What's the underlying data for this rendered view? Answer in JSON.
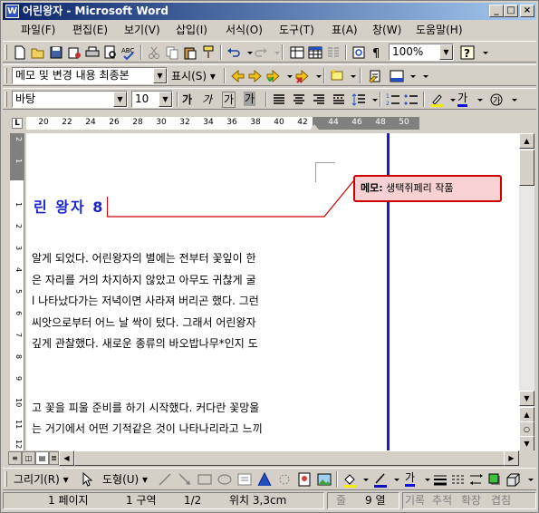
{
  "window": {
    "title": "어린왕자 - Microsoft Word",
    "icon": "word-doc-icon",
    "controls": [
      "minimize",
      "maximize",
      "close"
    ]
  },
  "menu": [
    "파일(F)",
    "편집(E)",
    "보기(V)",
    "삽입(I)",
    "서식(O)",
    "도구(T)",
    "표(A)",
    "창(W)",
    "도움말(H)"
  ],
  "toolbar_standard": {
    "zoom": "100%"
  },
  "toolbar_review": {
    "display_mode": "메모 및 변경 내용 최종본",
    "show_label": "표시(S)"
  },
  "toolbar_format": {
    "style": "바탕",
    "font_size": "10",
    "bold": "가",
    "italic": "가",
    "underline": "가",
    "shade": "가",
    "font_color": "가"
  },
  "ruler": {
    "numbers": [
      "20",
      "22",
      "24",
      "26",
      "28",
      "30",
      "32",
      "34",
      "36",
      "38",
      "40",
      "42",
      "44",
      "46",
      "48",
      "50"
    ],
    "tab_selector": "L"
  },
  "vruler": {
    "numbers": [
      "2",
      "1",
      "1",
      "2",
      "3",
      "4",
      "5",
      "6",
      "7",
      "8",
      "9",
      "10",
      "11",
      "12"
    ]
  },
  "document": {
    "heading": "린 왕자 8",
    "lines": [
      "알게 되었다. 어린왕자의 별에는 전부터 꽃잎이 한",
      "은 자리를 거의 차지하지 않았고 아무도 귀찮게 굴",
      "l 나타났다가는 저녁이면 사라져 버리곤 했다. 그런",
      " 씨앗으로부터 어느 날 싹이 텄다. 그래서 어린왕자",
      " 깊게 관찰했다. 새로운 종류의 바오밥나무*인지 도",
      "",
      "",
      "고 꽃을 피울 준비를 하기 시작했다. 커다란 꽃망울",
      "는 거기에서 어떤 기적같은 것이 나타나리라고 느끼"
    ]
  },
  "comment": {
    "label": "메모:",
    "text": "생택쥐페리 작품"
  },
  "drawing_toolbar": {
    "draw_label": "그리기(R)",
    "shapes_label": "도형(U)",
    "font_color": "가"
  },
  "status": {
    "page": "1 페이지",
    "section": "1 구역",
    "pages": "1/2",
    "position": "위치 3,3cm",
    "line": "줄",
    "column": "9 열",
    "rec": "기록",
    "track": "추적",
    "ext": "확장",
    "ovr": "겹침"
  },
  "colors": {
    "title_start": "#0a246a",
    "title_end": "#a6caf0",
    "heading": "#1b26c9",
    "comment_border": "#cc0000",
    "comment_fill": "#f8d2d2",
    "margin_bar": "#1a1ad6"
  }
}
